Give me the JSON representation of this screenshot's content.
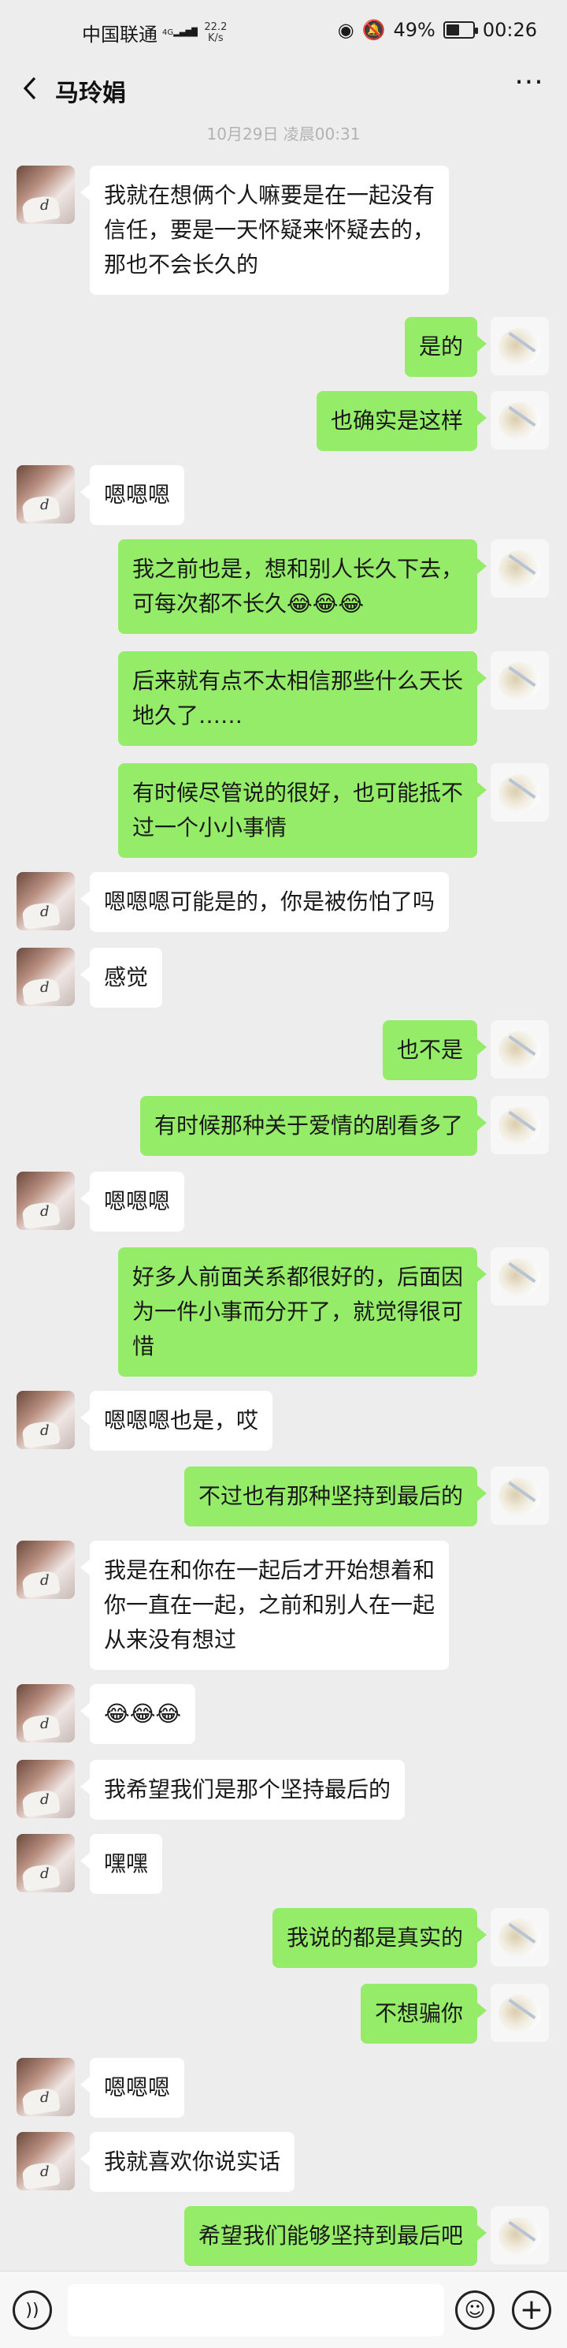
{
  "status_bar": {
    "carrier": "中国联通",
    "net_speed_value": "22.2",
    "net_speed_unit": "K/s",
    "signal_icon": "signal-bars-icon",
    "battery_percent_text": "49%",
    "battery_level": 0.49,
    "time": "00:26"
  },
  "header": {
    "title": "马玲娟",
    "back_icon": "chevron-left-icon",
    "more_icon": "more-dots-icon"
  },
  "time_divider": "10月29日 凌晨00:31",
  "messages": [
    {
      "side": "in",
      "text": "我就在想俩个人嘛要是在一起没有\n信任，要是一天怀疑来怀疑去的，\n那也不会长久的"
    },
    {
      "side": "out",
      "text": "是的"
    },
    {
      "side": "out",
      "text": "也确实是这样"
    },
    {
      "side": "in",
      "text": "嗯嗯嗯"
    },
    {
      "side": "out",
      "text": "我之前也是，想和别人长久下去，\n可每次都不长久😂😂😂"
    },
    {
      "side": "out",
      "text": "后来就有点不太相信那些什么天长\n地久了……"
    },
    {
      "side": "out",
      "text": "有时候尽管说的很好，也可能抵不\n过一个小小事情"
    },
    {
      "side": "in",
      "text": "嗯嗯嗯可能是的，你是被伤怕了吗"
    },
    {
      "side": "in",
      "text": "感觉"
    },
    {
      "side": "out",
      "text": "也不是"
    },
    {
      "side": "out",
      "text": "有时候那种关于爱情的剧看多了"
    },
    {
      "side": "in",
      "text": "嗯嗯嗯"
    },
    {
      "side": "out",
      "text": "好多人前面关系都很好的，后面因\n为一件小事而分开了，就觉得很可\n惜"
    },
    {
      "side": "in",
      "text": "嗯嗯嗯也是，哎"
    },
    {
      "side": "out",
      "text": "不过也有那种坚持到最后的"
    },
    {
      "side": "in",
      "text": "我是在和你在一起后才开始想着和\n你一直在一起，之前和别人在一起\n从来没有想过"
    },
    {
      "side": "in",
      "text": "😂😂😂"
    },
    {
      "side": "in",
      "text": "我希望我们是那个坚持最后的"
    },
    {
      "side": "in",
      "text": "嘿嘿"
    },
    {
      "side": "out",
      "text": "我说的都是真实的"
    },
    {
      "side": "out",
      "text": "不想骗你"
    },
    {
      "side": "in",
      "text": "嗯嗯嗯"
    },
    {
      "side": "in",
      "text": "我就喜欢你说实话"
    },
    {
      "side": "out",
      "text": "希望我们能够坚持到最后吧"
    }
  ],
  "input_bar": {
    "voice_icon": "voice-icon",
    "emoji_icon": "emoji-icon",
    "plus_icon": "plus-icon"
  }
}
